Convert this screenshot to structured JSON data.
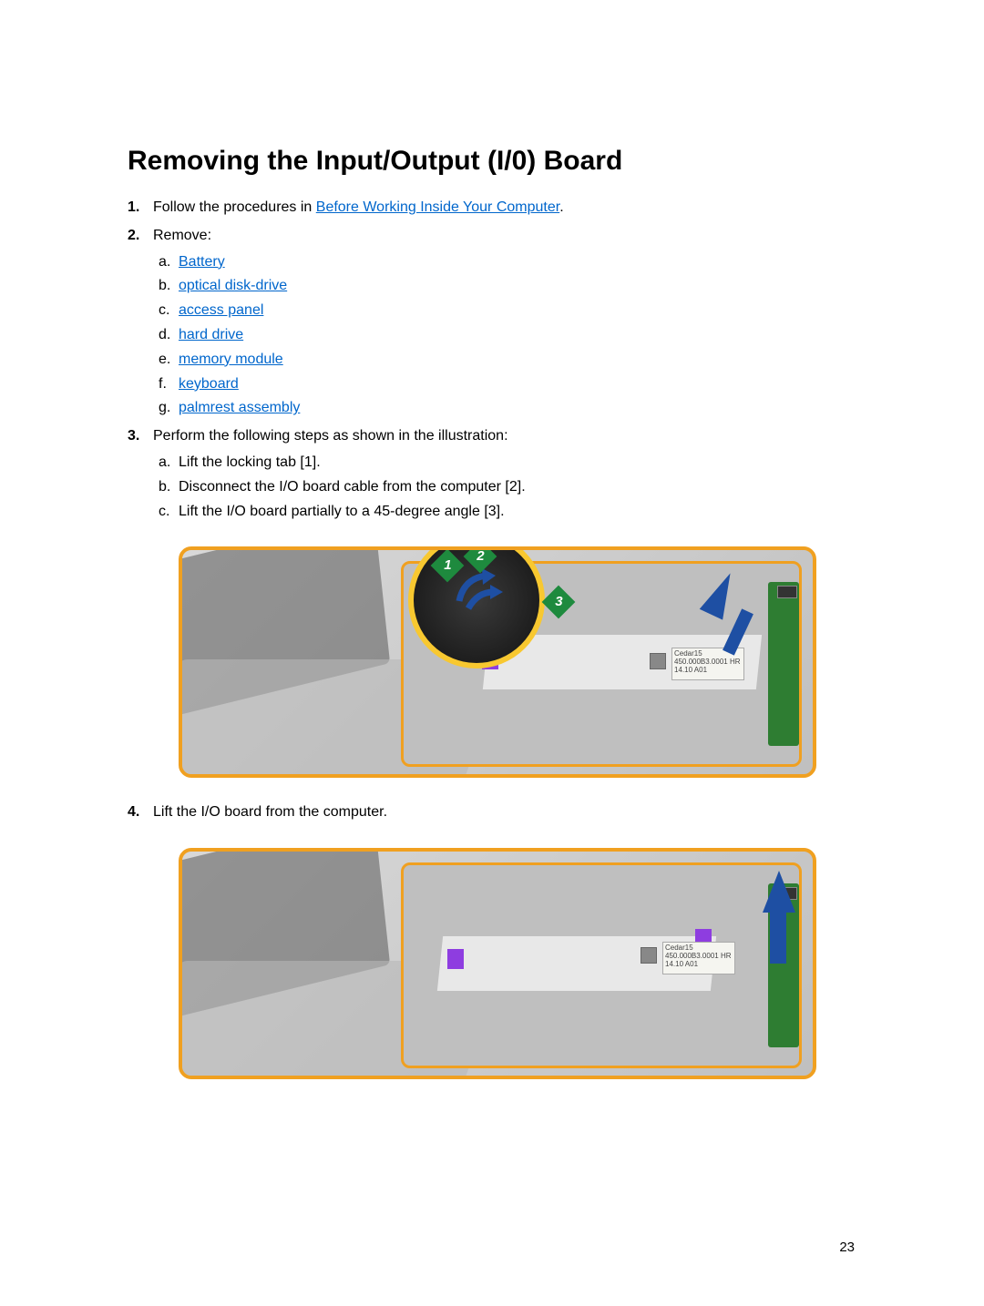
{
  "title": "Removing the Input/Output (I/0) Board",
  "steps": {
    "s1_prefix": "Follow the procedures in ",
    "s1_link": "Before Working Inside Your Computer",
    "s1_suffix": ".",
    "s2": "Remove:",
    "s2_items": {
      "a": "Battery",
      "b": "optical disk-drive",
      "c": "access panel",
      "d": "hard drive",
      "e": "memory module",
      "f": "keyboard",
      "g": "palmrest assembly"
    },
    "s3": "Perform the following steps as shown in the illustration:",
    "s3_items": {
      "a": "Lift the locking tab [1].",
      "b": "Disconnect the I/O board cable from the computer [2].",
      "c": "Lift the I/O board partially to a 45-degree angle [3]."
    },
    "s4": "Lift the I/O board from the computer."
  },
  "badges": {
    "b1": "1",
    "b2": "2",
    "b3": "3"
  },
  "label_text": "Cedar15\n450.000B3.0001\nHR 14.10 A01",
  "page_number": "23"
}
